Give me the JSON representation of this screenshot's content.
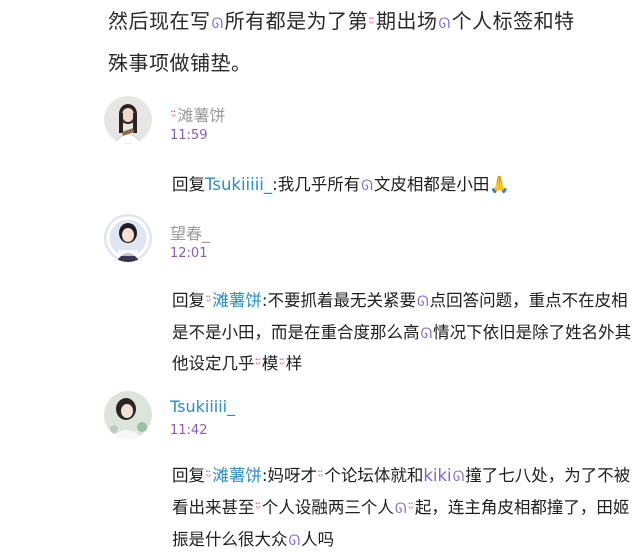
{
  "top_paragraph": {
    "line1_a": "然后现在写",
    "line1_b": "所有都是为了第",
    "line1_c": "期出场",
    "line1_d": "个人标签和特",
    "line2": "殊事项做铺垫。"
  },
  "comments": [
    {
      "username": "滩薯饼",
      "time": "11:59",
      "reply_prefix": "回复",
      "mention": "Tsukiiiii_",
      "text_a": ":我几乎所有",
      "text_b": "文皮相都是小田",
      "emoji": "🙏"
    },
    {
      "username": "望春_",
      "time": "12:01",
      "reply_prefix": "回复",
      "mention": "滩薯饼",
      "text_a": ":不要抓着最无关紧要",
      "text_b": "点回答问题，重点不",
      "text_c": "在皮相是不是小田，而是在重合度那么高",
      "text_d": "情况下依旧是除",
      "text_e": "了姓名外其他设定几乎",
      "text_f": "模",
      "text_g": "样"
    },
    {
      "username": "Tsukiiiii_",
      "time": "11:42",
      "reply_prefix": "回复",
      "mention": "滩薯饼",
      "text_a": ":妈呀才",
      "text_b": "个论坛体就和",
      "inline_name": "kiki",
      "text_c": "撞了七八处，为",
      "text_d": "了不被看出来甚至",
      "text_e": "个人设融两三个人",
      "text_f": "起，连主角皮相",
      "text_g": "都撞了，田姬振是什么很大众",
      "text_h": "人吗"
    }
  ],
  "icons": {
    "emoticon": "ᵕ̈",
    "swirl": "ᘏ"
  },
  "colors": {
    "accent_blue": "#2a8ec8",
    "time_purple": "#8a5cb8",
    "emoticon_pink": "#e0558a",
    "swirl_purple": "#7c66d6"
  }
}
